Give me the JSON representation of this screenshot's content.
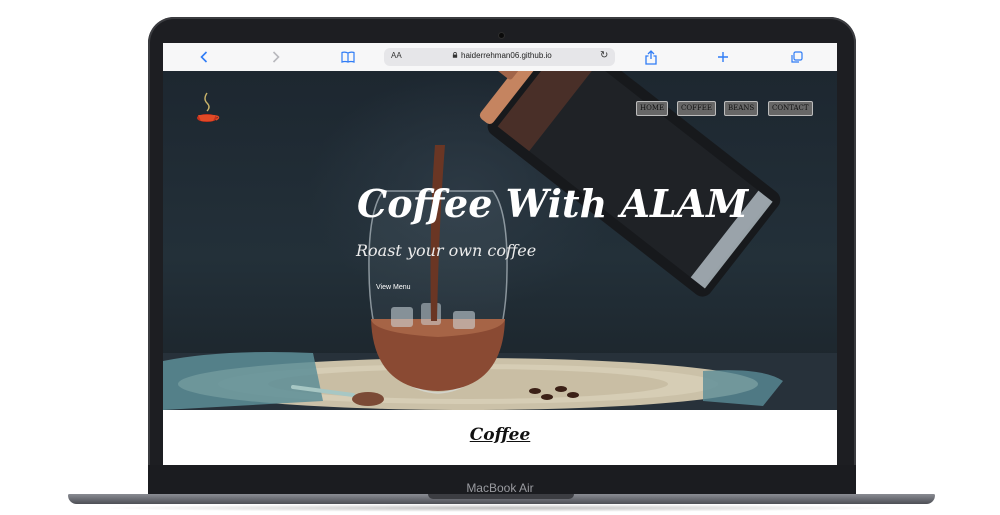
{
  "device": {
    "model_label": "MacBook Air"
  },
  "browser": {
    "aa_label": "AA",
    "url": "haiderrehman06.github.io",
    "icons": [
      "back-icon",
      "forward-icon",
      "bookmarks-icon",
      "lock-icon",
      "reload-icon",
      "share-icon",
      "new-tab-icon",
      "tabs-icon"
    ]
  },
  "site": {
    "nav": [
      "HOME",
      "COFFEE",
      "BEANS",
      "CONTACT"
    ],
    "hero_title": "Coffee With ALAM",
    "hero_subtitle": "Roast your own coffee",
    "cta": "View Menu",
    "section_title": "Coffee"
  },
  "colors": {
    "accent_blue": "#2f7cf6",
    "nav_bg": "#676767",
    "hero_dark": "#1f2a33"
  }
}
